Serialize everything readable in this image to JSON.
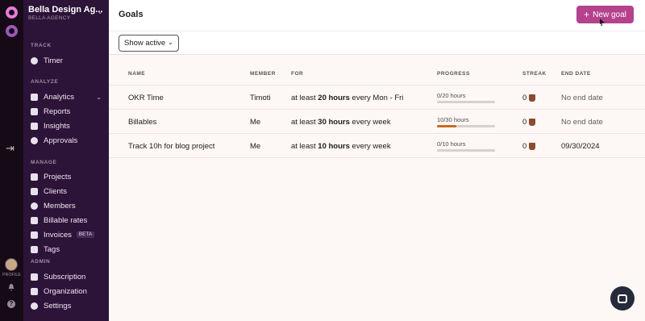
{
  "workspace": {
    "name": "Bella Design Ag...",
    "subtitle": "BELLA AGENCY"
  },
  "sidebar": {
    "sections": [
      {
        "label": "TRACK"
      },
      {
        "label": "ANALYZE"
      },
      {
        "label": "MANAGE"
      },
      {
        "label": "ADMIN"
      }
    ],
    "items": [
      {
        "label": "Timer",
        "icon": "clock-icon"
      },
      {
        "label": "Analytics",
        "icon": "chart-icon"
      },
      {
        "label": "Reports",
        "icon": "report-icon"
      },
      {
        "label": "Insights",
        "icon": "insights-icon"
      },
      {
        "label": "Approvals",
        "icon": "check-circle-icon"
      },
      {
        "label": "Projects",
        "icon": "folder-icon"
      },
      {
        "label": "Clients",
        "icon": "clients-icon"
      },
      {
        "label": "Members",
        "icon": "members-icon"
      },
      {
        "label": "Billable rates",
        "icon": "dollar-icon"
      },
      {
        "label": "Invoices",
        "icon": "invoice-icon",
        "badge": "BETA"
      },
      {
        "label": "Tags",
        "icon": "tag-icon"
      },
      {
        "label": "Subscription",
        "icon": "card-icon"
      },
      {
        "label": "Organization",
        "icon": "building-icon"
      },
      {
        "label": "Settings",
        "icon": "gear-icon"
      }
    ]
  },
  "rail": {
    "profile_label": "PROFILE"
  },
  "header": {
    "title": "Goals",
    "new_goal_label": "New goal"
  },
  "filter": {
    "selected": "Show active"
  },
  "table": {
    "columns": [
      "NAME",
      "MEMBER",
      "FOR",
      "PROGRESS",
      "STREAK",
      "END DATE"
    ],
    "rows": [
      {
        "name": "OKR Time",
        "member": "Timoti",
        "for_prefix": "at least ",
        "for_amount": "20 hours",
        "for_suffix": " every Mon - Fri",
        "progress_text": "0/20 hours",
        "progress": 0,
        "streak": "0",
        "end_date": "No end date"
      },
      {
        "name": "Billables",
        "member": "Me",
        "for_prefix": "at least ",
        "for_amount": "30 hours",
        "for_suffix": " every week",
        "progress_text": "10/30 hours",
        "progress": 0.333,
        "streak": "0",
        "end_date": "No end date"
      },
      {
        "name": "Track 10h for blog project",
        "member": "Me",
        "for_prefix": "at least ",
        "for_amount": "10 hours",
        "for_suffix": " every week",
        "progress_text": "0/10 hours",
        "progress": 0,
        "streak": "0",
        "end_date": "09/30/2024"
      }
    ]
  },
  "colors": {
    "accent": "#b5428d",
    "sidebar": "#2c1338",
    "rail": "#160a17",
    "progress_fill": "#c66b1f"
  }
}
